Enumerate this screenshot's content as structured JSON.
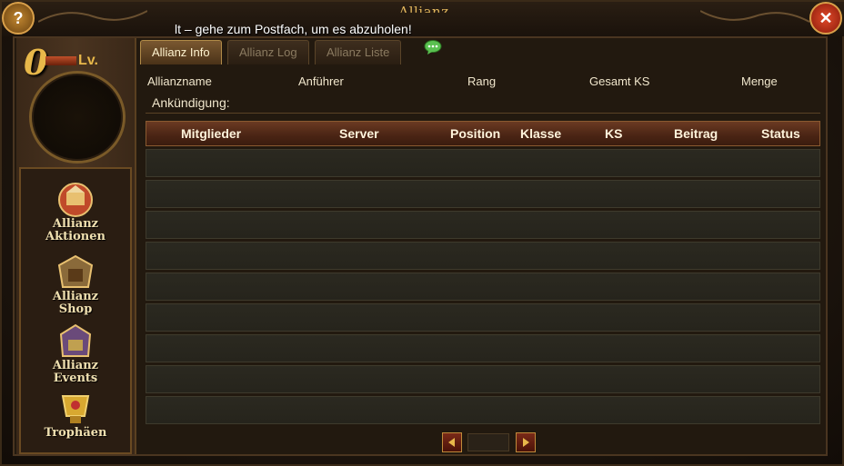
{
  "window": {
    "title": "Allianz",
    "notice": "lt – gehe zum Postfach, um es abzuholen!"
  },
  "buttons": {
    "help": "?",
    "close": "✕"
  },
  "level": {
    "value": "0",
    "label": "Lv."
  },
  "sidebar": {
    "items": [
      {
        "label": "Allianz\nAktionen",
        "icon": "alliance-actions-icon"
      },
      {
        "label": "Allianz\nShop",
        "icon": "alliance-shop-icon"
      },
      {
        "label": "Allianz\nEvents",
        "icon": "alliance-events-icon"
      },
      {
        "label": "Trophäen",
        "icon": "trophy-icon"
      }
    ]
  },
  "tabs": [
    {
      "label": "Allianz Info",
      "active": true
    },
    {
      "label": "Allianz Log",
      "active": false
    },
    {
      "label": "Allianz Liste",
      "active": false
    }
  ],
  "info": {
    "allianzname": "Allianzname",
    "anfuehrer": "Anführer",
    "rang": "Rang",
    "gesamt_ks": "Gesamt KS",
    "menge": "Menge",
    "ankuendigung": "Ankündigung:"
  },
  "table": {
    "headers": [
      "Mitglieder",
      "Server",
      "Position",
      "Klasse",
      "KS",
      "Beitrag",
      "Status"
    ],
    "rows": 9
  },
  "colors": {
    "accent": "#e0b55c",
    "header": "#4a2414"
  }
}
